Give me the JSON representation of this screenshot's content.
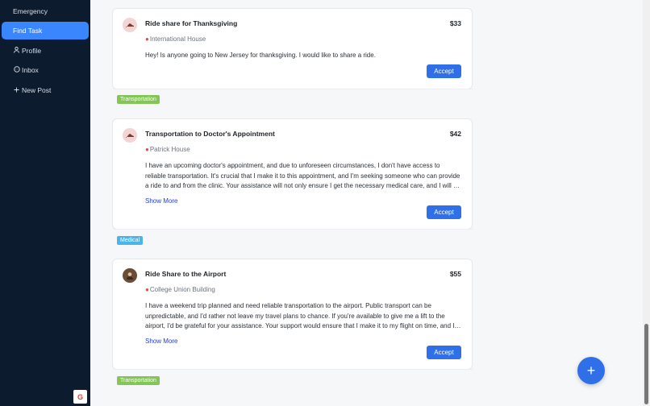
{
  "sidebar": {
    "items": [
      {
        "label": "Emergency",
        "icon": ""
      },
      {
        "label": "Find Task",
        "icon": ""
      },
      {
        "label": "Profile",
        "icon": "user-icon"
      },
      {
        "label": "Inbox",
        "icon": "chat-icon"
      },
      {
        "label": "New Post",
        "icon": "plus-icon"
      }
    ],
    "footer_badge": "G"
  },
  "tasks": [
    {
      "title": "Ride share for Thanksgiving",
      "price": "$33",
      "location": "International House",
      "description": "Hey! Is anyone going to New Jersey for thanksgiving. I would like to share a ride.",
      "show_more": "",
      "accept": "Accept",
      "tag": "Transportation",
      "tag_color": "#84c459"
    },
    {
      "title": "Transportation to Doctor's Appointment",
      "price": "$42",
      "location": "Patrick House",
      "description": "I have an upcoming doctor's appointment, and due to unforeseen circumstances, I don't have access to reliable transportation. It's crucial that I make it to this appointment, and I'm seeking someone who can provide a ride to and from the clinic. Your assistance will not only ensure I get the necessary medical care, and I will be grateful.",
      "show_more": "Show More",
      "accept": "Accept",
      "tag": "Medical",
      "tag_color": "#4ab5e8"
    },
    {
      "title": "Ride Share to the Airport",
      "price": "$55",
      "location": "College Union Building",
      "description": "I have a weekend trip planned and need reliable transportation to the airport. Public transport can be unpredictable, and I'd rather not leave my travel plans to chance. If you're available to give me a lift to the airport, I'd be grateful for your assistance. Your support would ensure that I make it to my flight on time, and I appreciate it.",
      "show_more": "Show More",
      "accept": "Accept",
      "tag": "Transportation",
      "tag_color": "#84c459"
    }
  ],
  "fab": {
    "label": "+"
  }
}
